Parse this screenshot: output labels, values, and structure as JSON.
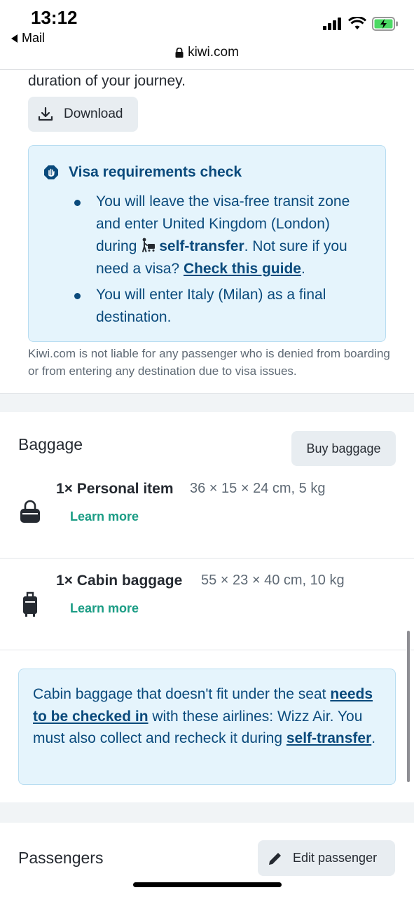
{
  "status": {
    "time": "13:12",
    "back_label": "Mail",
    "url": "kiwi.com"
  },
  "intro": {
    "text": "duration of your journey.",
    "download_label": "Download"
  },
  "visa": {
    "title": "Visa requirements check",
    "item1_pre": "You will leave the visa-free transit zone and enter United Kingdom (London) during",
    "item1_bold": "self-transfer",
    "item1_mid": ". Not sure if you need a visa?",
    "item1_link": "Check this guide",
    "item1_end": ".",
    "item2": "You will enter Italy (Milan) as a final destination."
  },
  "disclaimer": "Kiwi.com is not liable for any passenger who is denied from boarding or from entering any destination due to visa issues.",
  "baggage": {
    "title": "Baggage",
    "buy_label": "Buy baggage",
    "items": [
      {
        "name": "1× Personal item",
        "dims": "36 × 15 × 24 cm, 5 kg",
        "learn_more": "Learn more",
        "icon": "handbag-icon"
      },
      {
        "name": "1× Cabin baggage",
        "dims": "55 × 23 × 40 cm, 10 kg",
        "learn_more": "Learn more",
        "icon": "suitcase-icon"
      }
    ],
    "note_pre": "Cabin baggage that doesn't fit under the seat",
    "note_link1": "needs to be checked in",
    "note_mid": "with these airlines: Wizz Air. You must also collect and recheck it during",
    "note_link2": "self-transfer",
    "note_end": "."
  },
  "passengers": {
    "title": "Passengers",
    "edit_label": "Edit passenger"
  },
  "colors": {
    "accent_blue": "#0a4a7c",
    "info_bg": "#e5f4fc",
    "link_green": "#1a9c84"
  }
}
